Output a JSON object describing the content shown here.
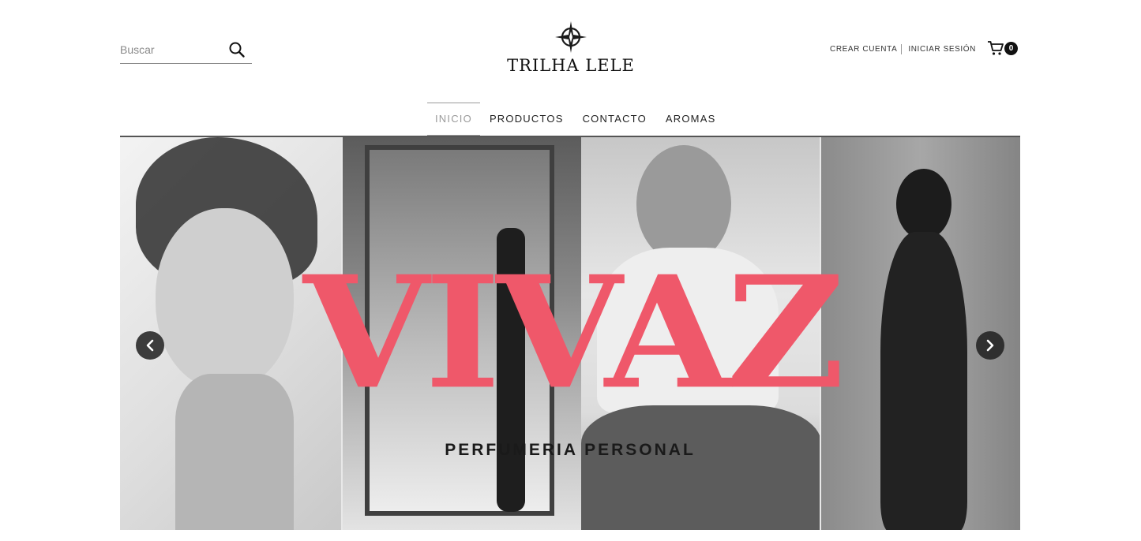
{
  "search": {
    "placeholder": "Buscar",
    "icon": "search-icon"
  },
  "logo": {
    "brand": "TRILHA LELE",
    "icon": "compass-rose-icon"
  },
  "account": {
    "create_label": "CREAR CUENTA",
    "login_label": "INICIAR SESIÓN"
  },
  "cart": {
    "icon": "cart-icon",
    "count": "0"
  },
  "nav": {
    "items": [
      {
        "label": "INICIO",
        "active": true
      },
      {
        "label": "PRODUCTOS",
        "active": false
      },
      {
        "label": "CONTACTO",
        "active": false
      },
      {
        "label": "AROMAS",
        "active": false
      }
    ]
  },
  "hero": {
    "title": "VIVAZ",
    "subtitle": "PERFUMERIA PERSONAL",
    "title_color": "#ef586a",
    "prev_icon": "chevron-left-icon",
    "next_icon": "chevron-right-icon"
  }
}
